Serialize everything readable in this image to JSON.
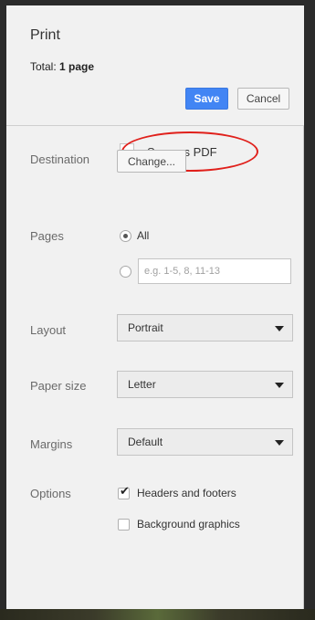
{
  "dialog": {
    "title": "Print",
    "total_prefix": "Total: ",
    "total_value": "1 page",
    "save_label": "Save",
    "cancel_label": "Cancel"
  },
  "destination": {
    "label": "Destination",
    "value": "Save as PDF",
    "change_label": "Change..."
  },
  "pages": {
    "label": "Pages",
    "all_label": "All",
    "all_selected": true,
    "range_placeholder": "e.g. 1-5, 8, 11-13"
  },
  "layout": {
    "label": "Layout",
    "selected": "Portrait"
  },
  "paper_size": {
    "label": "Paper size",
    "selected": "Letter"
  },
  "margins": {
    "label": "Margins",
    "selected": "Default"
  },
  "options": {
    "label": "Options",
    "headers_footers_label": "Headers and footers",
    "headers_footers_checked": true,
    "background_graphics_label": "Background graphics",
    "background_graphics_checked": false
  },
  "colors": {
    "accent": "#4285f4",
    "annotation": "#e0201b"
  }
}
